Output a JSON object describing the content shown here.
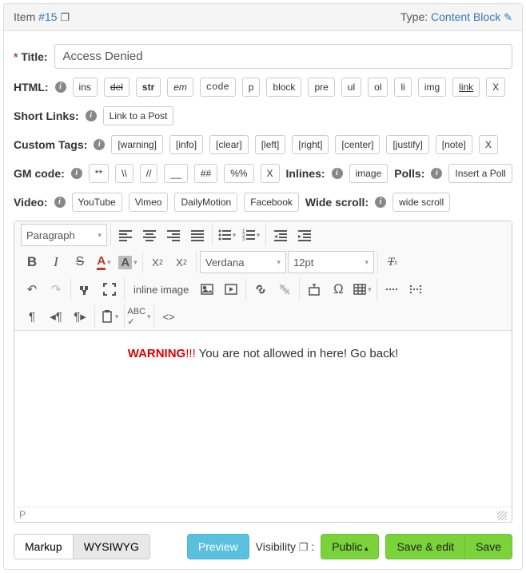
{
  "header": {
    "item_label": "Item",
    "item_number": "#15",
    "type_label": "Type:",
    "type_value": "Content Block"
  },
  "title": {
    "label": "Title:",
    "value": "Access Denied"
  },
  "rows": {
    "html": {
      "label": "HTML:",
      "buttons": [
        "ins",
        "del",
        "str",
        "em",
        "code",
        "p",
        "block",
        "pre",
        "ul",
        "ol",
        "li",
        "img",
        "link",
        "X"
      ]
    },
    "shortlinks": {
      "label": "Short Links:",
      "buttons": [
        "Link to a Post"
      ]
    },
    "customtags": {
      "label": "Custom Tags:",
      "buttons": [
        "[warning]",
        "[info]",
        "[clear]",
        "[left]",
        "[right]",
        "[center]",
        "[justify]",
        "[note]",
        "X"
      ]
    },
    "gmcode": {
      "label": "GM code:",
      "buttons": [
        "**",
        "\\\\",
        "//",
        "__",
        "##",
        "%%",
        "X"
      ],
      "inlines_label": "Inlines:",
      "inlines_buttons": [
        "image"
      ],
      "polls_label": "Polls:",
      "polls_buttons": [
        "Insert a Poll"
      ]
    },
    "video": {
      "label": "Video:",
      "buttons": [
        "YouTube",
        "Vimeo",
        "DailyMotion",
        "Facebook"
      ],
      "wide_label": "Wide scroll:",
      "wide_buttons": [
        "wide scroll"
      ]
    }
  },
  "editor_toolbar": {
    "format_select": "Paragraph",
    "font_select": "Verdana",
    "size_select": "12pt",
    "inline_image_text": "inline image"
  },
  "editor_content": {
    "warn": "WARNING",
    "bang": "!!!",
    "rest": " You are not allowed in here! Go back!"
  },
  "editor_status": "P",
  "footer": {
    "markup": "Markup",
    "wysiwyg": "WYSIWYG",
    "preview": "Preview",
    "visibility_label": "Visibility",
    "visibility_colon": ":",
    "public": "Public",
    "save_edit": "Save & edit",
    "save": "Save"
  }
}
